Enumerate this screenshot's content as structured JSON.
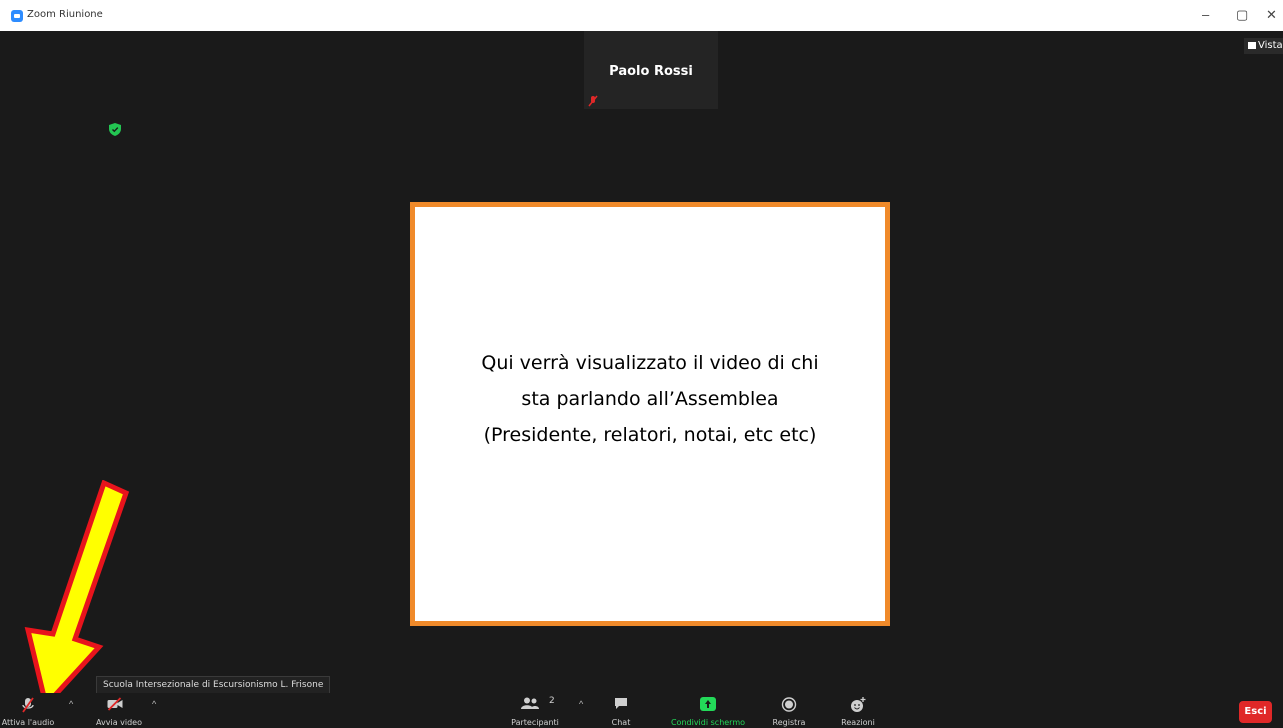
{
  "window": {
    "title": "Zoom Riunione",
    "min": "–",
    "restore": "▢",
    "close": "✕"
  },
  "thumbnail": {
    "participant_name": "Paolo Rossi"
  },
  "view_button": {
    "label": "Vista"
  },
  "main": {
    "message_lines": [
      "Qui verrà visualizzato il video di chi",
      "sta parlando all’Assemblea",
      "(Presidente, relatori, notai, etc etc)"
    ]
  },
  "tooltip": {
    "text": "Scuola Intersezionale di Escursionismo L. Frisone"
  },
  "toolbar": {
    "audio_label": "Attiva l'audio",
    "video_label": "Avvia video",
    "participants_label": "Partecipanti",
    "participants_count": "2",
    "chat_label": "Chat",
    "share_label": "Condividi schermo",
    "record_label": "Registra",
    "reactions_label": "Reazioni",
    "leave_label": "Esci"
  },
  "colors": {
    "share_green": "#23d959",
    "leave_red": "#e02828",
    "frame_orange": "#f08a2a",
    "arrow_yellow": "#ffff00",
    "arrow_red": "#e8141c"
  }
}
